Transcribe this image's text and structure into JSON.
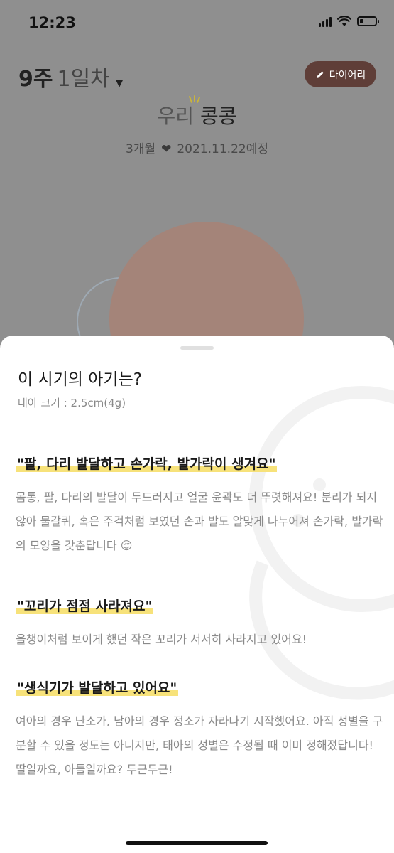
{
  "status": {
    "time": "12:23",
    "battery_percent": 25
  },
  "header": {
    "week": "9주",
    "day": "1일차",
    "diary_label": "다이어리",
    "prefix": "우리",
    "nickname": "콩콩",
    "months": "3개월",
    "due": "2021.11.22예정"
  },
  "sheet": {
    "title": "이 시기의 아기는?",
    "size": "태아 크기 : 2.5cm(4g)",
    "sections": [
      {
        "heading": "\"팔, 다리 발달하고 손가락, 발가락이 생겨요\"",
        "body": "몸통, 팔, 다리의 발달이 두드러지고 얼굴 윤곽도 더 뚜렷해져요! 분리가 되지 않아 물갈퀴, 혹은 주걱처럼 보였던 손과 발도 알맞게 나누어져 손가락, 발가락의 모양을 갖춘답니다 😌"
      },
      {
        "heading": "\"꼬리가 점점 사라져요\"",
        "body": "올챙이처럼 보이게 했던 작은 꼬리가 서서히 사라지고 있어요!"
      },
      {
        "heading": "\"생식기가 발달하고 있어요\"",
        "body": "여아의 경우 난소가, 남아의 경우 정소가 자라나기 시작했어요. 아직 성별을 구분할 수 있을 정도는 아니지만, 태아의 성별은 수정될 때 이미 정해졌답니다! 딸일까요, 아들일까요? 두근두근!"
      }
    ]
  },
  "colors": {
    "accent_brown": "#5f3e38",
    "highlight": "#f7e27a",
    "circle": "#a48479"
  }
}
